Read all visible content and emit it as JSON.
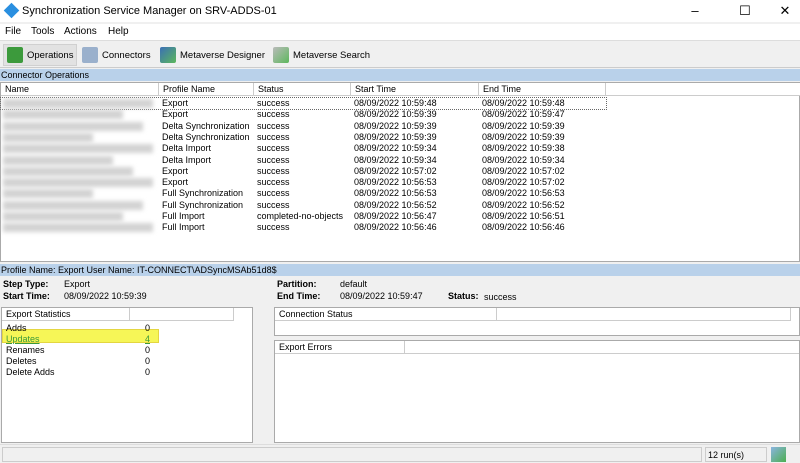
{
  "window": {
    "title": "Synchronization Service Manager on SRV-ADDS-01",
    "controls": [
      "–",
      "☐",
      "✕"
    ]
  },
  "menu": [
    "File",
    "Tools",
    "Actions",
    "Help"
  ],
  "toolbar": [
    {
      "label": "Operations",
      "icon": "operations-book-icon",
      "active": true
    },
    {
      "label": "Connectors",
      "icon": "connectors-icon"
    },
    {
      "label": "Metaverse Designer",
      "icon": "metaverse-designer-icon"
    },
    {
      "label": "Metaverse Search",
      "icon": "metaverse-search-icon"
    }
  ],
  "operations": {
    "section_title": "Connector Operations",
    "columns": [
      "Name",
      "Profile Name",
      "Status",
      "Start Time",
      "End Time"
    ],
    "rows": [
      {
        "profile": "Export",
        "status": "success",
        "start": "08/09/2022 10:59:48",
        "end": "08/09/2022 10:59:48"
      },
      {
        "profile": "Export",
        "status": "success",
        "start": "08/09/2022 10:59:39",
        "end": "08/09/2022 10:59:47"
      },
      {
        "profile": "Delta Synchronization",
        "status": "success",
        "start": "08/09/2022 10:59:39",
        "end": "08/09/2022 10:59:39"
      },
      {
        "profile": "Delta Synchronization",
        "status": "success",
        "start": "08/09/2022 10:59:39",
        "end": "08/09/2022 10:59:39"
      },
      {
        "profile": "Delta Import",
        "status": "success",
        "start": "08/09/2022 10:59:34",
        "end": "08/09/2022 10:59:38"
      },
      {
        "profile": "Delta Import",
        "status": "success",
        "start": "08/09/2022 10:59:34",
        "end": "08/09/2022 10:59:34"
      },
      {
        "profile": "Export",
        "status": "success",
        "start": "08/09/2022 10:57:02",
        "end": "08/09/2022 10:57:02"
      },
      {
        "profile": "Export",
        "status": "success",
        "start": "08/09/2022 10:56:53",
        "end": "08/09/2022 10:57:02"
      },
      {
        "profile": "Full Synchronization",
        "status": "success",
        "start": "08/09/2022 10:56:53",
        "end": "08/09/2022 10:56:53"
      },
      {
        "profile": "Full Synchronization",
        "status": "success",
        "start": "08/09/2022 10:56:52",
        "end": "08/09/2022 10:56:52"
      },
      {
        "profile": "Full Import",
        "status": "completed-no-objects",
        "start": "08/09/2022 10:56:47",
        "end": "08/09/2022 10:56:51"
      },
      {
        "profile": "Full Import",
        "status": "success",
        "start": "08/09/2022 10:56:46",
        "end": "08/09/2022 10:56:46"
      }
    ]
  },
  "details": {
    "band": "Profile Name: Export  User Name: IT-CONNECT\\ADSyncMSAb51d8$",
    "step_type_label": "Step Type:",
    "step_type": "Export",
    "start_time_label": "Start Time:",
    "start_time": "08/09/2022 10:59:39",
    "partition_label": "Partition:",
    "partition": "default",
    "end_time_label": "End Time:",
    "end_time": "08/09/2022 10:59:47",
    "status_label": "Status:",
    "status": "success",
    "export_stats_header": "Export Statistics",
    "stats": [
      {
        "label": "Adds",
        "value": "0"
      },
      {
        "label": "Updates",
        "value": "4",
        "link": true,
        "highlight": true
      },
      {
        "label": "Renames",
        "value": "0"
      },
      {
        "label": "Deletes",
        "value": "0"
      },
      {
        "label": "Delete Adds",
        "value": "0"
      }
    ],
    "connection_status_header": "Connection Status",
    "export_errors_header": "Export Errors"
  },
  "statusbar": {
    "runs": "12 run(s)"
  },
  "colors": {
    "band": "#b9d1ea",
    "highlight": "#f5f53a",
    "link": "#3a9a3a"
  }
}
